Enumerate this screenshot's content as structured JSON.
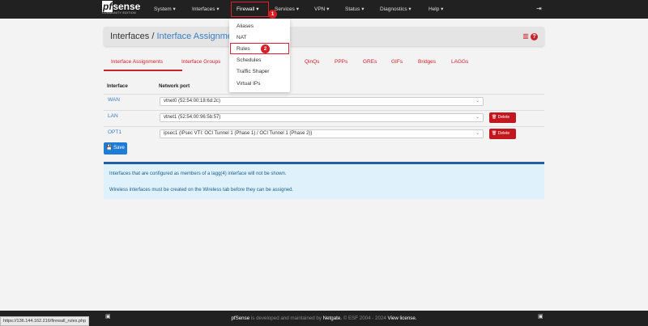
{
  "nav": {
    "logo": "pfsense",
    "logo_prefix": "pf",
    "logo_rest": "sense",
    "logo_sub": "COMMUNITY EDITION",
    "menus": [
      "System",
      "Interfaces",
      "Firewall",
      "Services",
      "VPN",
      "Status",
      "Diagnostics",
      "Help"
    ]
  },
  "annotations": [
    "1",
    "2"
  ],
  "firewall_menu": [
    "Aliases",
    "NAT",
    "Rules",
    "Schedules",
    "Traffic Shaper",
    "Virtual IPs"
  ],
  "breadcrumb": {
    "parent": "Interfaces /",
    "current": "Interface Assignments"
  },
  "tabs": [
    "Interface Assignments",
    "Interface Groups",
    "QinQs",
    "PPPs",
    "GREs",
    "GIFs",
    "Bridges",
    "LAGGs"
  ],
  "table": {
    "headers": [
      "Interface",
      "Network port"
    ],
    "rows": [
      {
        "iface": "WAN",
        "port": "vtnet0 (52:54:00:18:6d:2c)"
      },
      {
        "iface": "LAN",
        "port": "vtnet1 (52:54:00:96:5b:57)",
        "action": "Delete"
      },
      {
        "iface": "OPT1",
        "port": "ipsec1 (IPsec VTI: OCI Tunnel 1 (Phase 1) / OCI Tunnel 1 (Phase 2))",
        "action": "Delete"
      }
    ]
  },
  "save_label": "Save",
  "info": [
    "Interfaces that are configured as members of a lagg(4) interface will not be shown.",
    "Wireless interfaces must be created on the Wireless tab before they can be assigned."
  ],
  "footer": {
    "brand": "pfSense",
    "text1": " is developed and maintained by ",
    "netgate": "Netgate.",
    "text2": " © ESF 2004 - 2024 ",
    "license": "View license."
  },
  "status_url": "https://136.144.162.216/firewall_rules.php"
}
